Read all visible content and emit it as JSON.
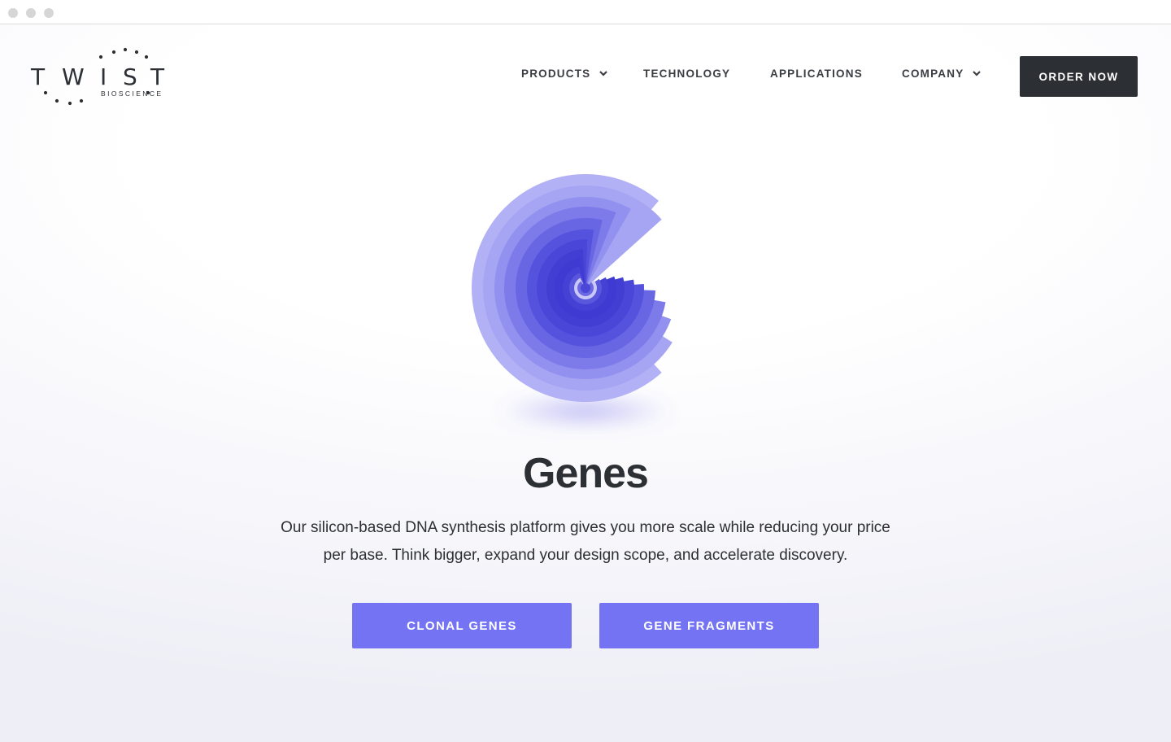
{
  "window": {
    "controls": [
      "close",
      "minimize",
      "maximize"
    ]
  },
  "logo": {
    "letters": [
      "T",
      "W",
      "I",
      "S",
      "T"
    ],
    "subtitle": "BIOSCIENCE"
  },
  "nav": {
    "items": [
      {
        "label": "PRODUCTS",
        "has_dropdown": true,
        "icon": "chevron-down-icon"
      },
      {
        "label": "TECHNOLOGY",
        "has_dropdown": false
      },
      {
        "label": "APPLICATIONS",
        "has_dropdown": false
      },
      {
        "label": "COMPANY",
        "has_dropdown": true,
        "icon": "chevron-down-icon"
      }
    ],
    "order_button": "ORDER NOW"
  },
  "hero": {
    "graphic": "genes-spiral-icon",
    "title": "Genes",
    "description": "Our silicon-based DNA synthesis platform gives you more scale while reducing your price per base. Think bigger, expand your design scope, and accelerate discovery.",
    "buttons": [
      "CLONAL GENES",
      "GENE FRAGMENTS"
    ]
  },
  "colors": {
    "accent": "#7473f3",
    "dark": "#2c2f33",
    "graphic_light": "#a9a8f1",
    "graphic_deep": "#3f3ad2"
  }
}
